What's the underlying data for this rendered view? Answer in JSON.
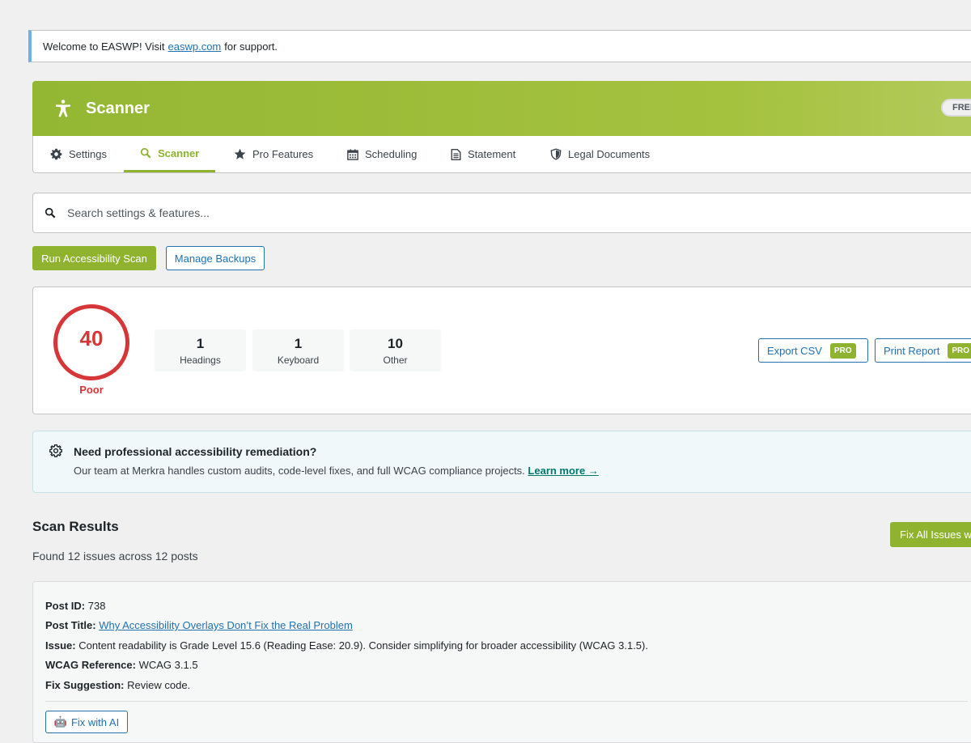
{
  "notice": {
    "prefix": "Welcome to EASWP! Visit",
    "link": "easwp.com",
    "suffix": "for support."
  },
  "header": {
    "title": "Scanner",
    "badge": "FREE",
    "logo_icon": "accessibility-person-icon"
  },
  "tabs": [
    {
      "label": "Settings",
      "icon": "gear-icon"
    },
    {
      "label": "Scanner",
      "icon": "search-icon",
      "active": true
    },
    {
      "label": "Pro Features",
      "icon": "star-icon"
    },
    {
      "label": "Scheduling",
      "icon": "calendar-icon"
    },
    {
      "label": "Statement",
      "icon": "document-icon"
    },
    {
      "label": "Legal Documents",
      "icon": "shield-icon"
    }
  ],
  "search": {
    "placeholder": "Search settings & features..."
  },
  "actions": {
    "run_scan": "Run Accessibility Scan",
    "manage_backups": "Manage Backups"
  },
  "score": {
    "value": "40",
    "grade": "Poor",
    "color": "#d63638",
    "stats": [
      {
        "value": "1",
        "label": "Headings"
      },
      {
        "value": "1",
        "label": "Keyboard"
      },
      {
        "value": "10",
        "label": "Other"
      }
    ],
    "export_csv": "Export CSV",
    "print_report": "Print Report",
    "pro_tag": "PRO"
  },
  "promo": {
    "heading": "Need professional accessibility remediation?",
    "text": "Our team at Merkra handles custom audits, code-level fixes, and full WCAG compliance projects.",
    "link": "Learn more →"
  },
  "results": {
    "title": "Scan Results",
    "summary": "Found 12 issues across 12 posts",
    "fix_all": "Fix All Issues w",
    "item": {
      "post_id_label": "Post ID:",
      "post_id": "738",
      "post_title_label": "Post Title:",
      "post_title": "Why Accessibility Overlays Don’t Fix the Real Problem",
      "issue_label": "Issue:",
      "issue": "Content readability is Grade Level 15.6 (Reading Ease: 20.9). Consider simplifying for broader accessibility (WCAG 3.1.5).",
      "wcag_label": "WCAG Reference:",
      "wcag": "WCAG 3.1.5",
      "fix_label": "Fix Suggestion:",
      "fix": "Review code.",
      "fix_ai": "Fix with AI",
      "fix_ai_icon": "robot-icon"
    }
  },
  "colors": {
    "brand": "#8fb22f",
    "link": "#2271b1",
    "danger": "#d63638"
  }
}
